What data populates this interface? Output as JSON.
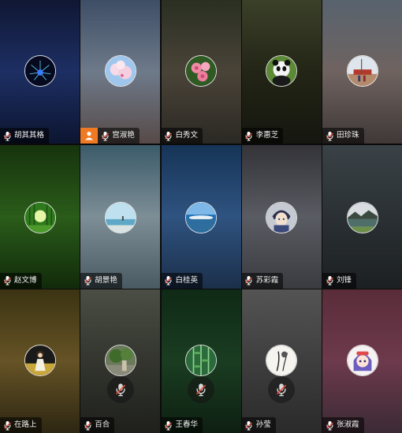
{
  "participants": [
    {
      "name": "胡其其格",
      "avatar_icon": "fireworks-photo-icon",
      "muted": false,
      "host": false,
      "bg": [
        "#0f1733",
        "#1d2f63",
        "#0c1530"
      ]
    },
    {
      "name": "宫淑艳",
      "avatar_icon": "cherry-blossom-photo-icon",
      "muted": false,
      "host": true,
      "bg": [
        "#3e4e66",
        "#6e7a8a",
        "#574a48"
      ]
    },
    {
      "name": "白秀文",
      "avatar_icon": "pink-roses-photo-icon",
      "muted": false,
      "host": false,
      "bg": [
        "#2a2f22",
        "#4a4338",
        "#2b2924"
      ]
    },
    {
      "name": "李惠芝",
      "avatar_icon": "panda-photo-icon",
      "muted": false,
      "host": false,
      "bg": [
        "#3b4029",
        "#232516",
        "#15160f"
      ]
    },
    {
      "name": "田珍珠",
      "avatar_icon": "tiananmen-photo-icon",
      "muted": false,
      "host": false,
      "bg": [
        "#58636e",
        "#6f6360",
        "#3f3836"
      ]
    },
    {
      "name": "赵文博",
      "avatar_icon": "forest-sunlight-photo-icon",
      "muted": false,
      "host": false,
      "bg": [
        "#17330d",
        "#2a5c1a",
        "#112a0a"
      ]
    },
    {
      "name": "胡景艳",
      "avatar_icon": "beach-photo-icon",
      "muted": false,
      "host": false,
      "bg": [
        "#3b5b69",
        "#7d8e96",
        "#4a5a62"
      ]
    },
    {
      "name": "白桂英",
      "avatar_icon": "lake-photo-icon",
      "muted": false,
      "host": false,
      "bg": [
        "#163457",
        "#2f5380",
        "#1b2f4a"
      ]
    },
    {
      "name": "苏彩霞",
      "avatar_icon": "anime-boy-photo-icon",
      "muted": false,
      "host": false,
      "bg": [
        "#333338",
        "#5a5c63",
        "#3a3b40"
      ]
    },
    {
      "name": "刘锋",
      "avatar_icon": "mountain-lake-photo-icon",
      "muted": false,
      "host": false,
      "bg": [
        "#3a4247",
        "#2a3033",
        "#1c2022"
      ]
    },
    {
      "name": "在路上",
      "avatar_icon": "girl-in-field-photo-icon",
      "muted": false,
      "host": false,
      "bg": [
        "#3b3312",
        "#665326",
        "#2d2612"
      ]
    },
    {
      "name": "百合",
      "avatar_icon": "garden-photo-icon",
      "muted": true,
      "host": false,
      "bg": [
        "#4a4e44",
        "#33352e",
        "#1f201c"
      ]
    },
    {
      "name": "王春华",
      "avatar_icon": "bamboo-photo-icon",
      "muted": true,
      "host": false,
      "bg": [
        "#0f2a16",
        "#1a3d21",
        "#0e1f12"
      ]
    },
    {
      "name": "孙莹",
      "avatar_icon": "ink-sketch-photo-icon",
      "muted": true,
      "host": false,
      "bg": [
        "#545454",
        "#3e3e3e",
        "#2a2a2a"
      ]
    },
    {
      "name": "张淑霞",
      "avatar_icon": "cartoon-girl-photo-icon",
      "muted": false,
      "host": false,
      "bg": [
        "#5a2c3a",
        "#6d3a4c",
        "#3b2a35"
      ]
    }
  ]
}
